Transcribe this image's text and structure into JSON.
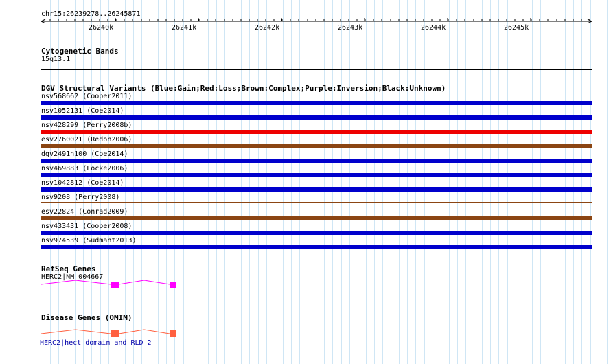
{
  "ruler": {
    "position": "chr15:26239278..26245871",
    "ticks": [
      "26240k",
      "26241k",
      "26242k",
      "26243k",
      "26244k",
      "26245k"
    ]
  },
  "cyto": {
    "title": "Cytogenetic Bands",
    "band": "15q13.1"
  },
  "dgv": {
    "title": "DGV Structural Variants (Blue:Gain;Red:Loss;Brown:Complex;Purple:Inversion;Black:Unknown)",
    "colors": {
      "gain": "#0000cc",
      "loss": "#ee0000",
      "complex": "#8b4513"
    },
    "variants": [
      {
        "label": "nsv568662 (Cooper2011)",
        "type": "gain"
      },
      {
        "label": "nsv1052131 (Coe2014)",
        "type": "gain"
      },
      {
        "label": "nsv428299 (Perry2008b)",
        "type": "loss"
      },
      {
        "label": "esv2760021 (Redon2006)",
        "type": "complex"
      },
      {
        "label": "dgv2491n100 (Coe2014)",
        "type": "gain"
      },
      {
        "label": "nsv469883 (Locke2006)",
        "type": "gain"
      },
      {
        "label": "nsv1042812 (Coe2014)",
        "type": "gain"
      },
      {
        "label": "nsv9208 (Perry2008)",
        "type": "complex_thin"
      },
      {
        "label": "esv22824 (Conrad2009)",
        "type": "complex"
      },
      {
        "label": "nsv433431 (Cooper2008)",
        "type": "gain"
      },
      {
        "label": "nsv974539 (Sudmant2013)",
        "type": "gain"
      }
    ]
  },
  "refseq": {
    "title": "RefSeq Genes",
    "gene": "HERC2|NM_004667",
    "color": "#ff00ff"
  },
  "disease": {
    "title": "Disease Genes (OMIM)",
    "gene": "HERC2|hect domain and RLD 2",
    "color": "#ff6040",
    "label_color": "#0000aa"
  }
}
